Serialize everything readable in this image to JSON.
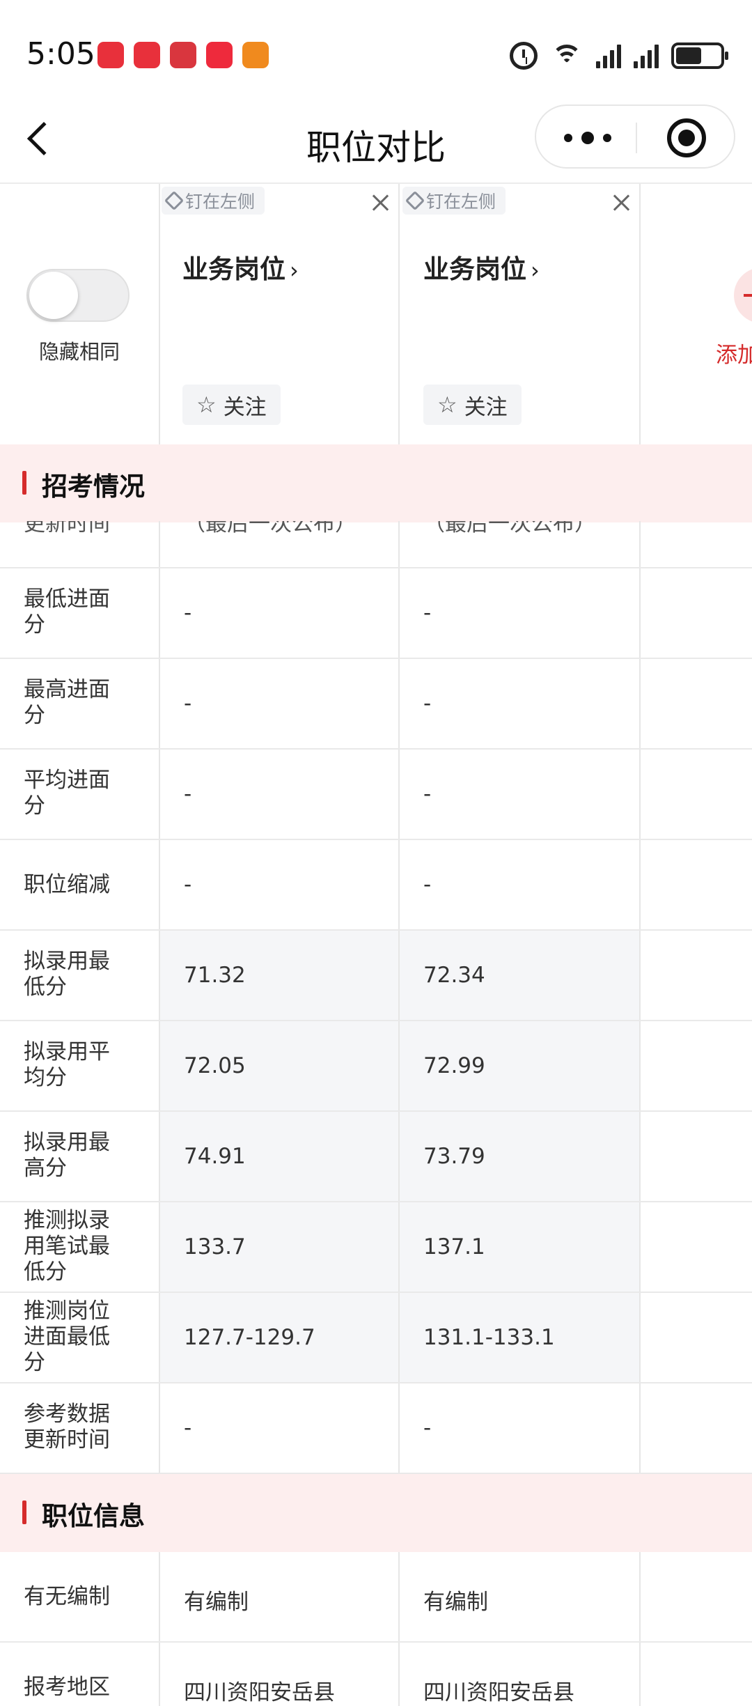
{
  "status_bar": {
    "time": "5:05",
    "apps": [
      {
        "icon": "huawei-store-icon",
        "label": "HUAWEI",
        "color": "#e8303b"
      },
      {
        "icon": "huawei-store-icon",
        "label": "HUAWEI",
        "color": "#e8303b"
      },
      {
        "icon": "game-app-icon",
        "label": "",
        "color": "#d9363e"
      },
      {
        "icon": "xiaohongshu-icon",
        "label": "小红书",
        "color": "#ee2a3c"
      },
      {
        "icon": "shopping-app-icon",
        "label": "",
        "color": "#f08a1e"
      }
    ],
    "icons": [
      "alarm-icon",
      "wifi-6-icon",
      "signal-icon",
      "signal-icon",
      "battery-icon"
    ]
  },
  "nav": {
    "title": "职位对比",
    "back_icon": "chevron-left-icon",
    "more_icon": "more-dots-icon",
    "close_icon": "target-circle-icon"
  },
  "compare": {
    "hide_same_label": "隐藏相同",
    "hide_same_on": false,
    "columns": [
      {
        "pin_label": "钉在左侧",
        "title": "业务岗位",
        "follow_label": "关注"
      },
      {
        "pin_label": "钉在左侧",
        "title": "业务岗位",
        "follow_label": "关注"
      }
    ],
    "add_label": "添加"
  },
  "sections": {
    "exam": {
      "title": "招考情况",
      "clipped_row": {
        "label": "更新时间",
        "a": "（最后一次公布）",
        "b": "（最后一次公布）"
      },
      "rows": [
        {
          "label": "最低进面分",
          "a": "-",
          "b": "-"
        },
        {
          "label": "最高进面分",
          "a": "-",
          "b": "-"
        },
        {
          "label": "平均进面分",
          "a": "-",
          "b": "-"
        },
        {
          "label": "职位缩减",
          "a": "-",
          "b": "-"
        },
        {
          "label": "拟录用最低分",
          "a": "71.32",
          "b": "72.34"
        },
        {
          "label": "拟录用平均分",
          "a": "72.05",
          "b": "72.99"
        },
        {
          "label": "拟录用最高分",
          "a": "74.91",
          "b": "73.79"
        },
        {
          "label": "推测拟录用笔试最低分",
          "a": "133.7",
          "b": "137.1"
        },
        {
          "label": "推测岗位进面最低分",
          "a": "127.7-129.7",
          "b": "131.1-133.1"
        },
        {
          "label": "参考数据更新时间",
          "a": "-",
          "b": "-"
        }
      ]
    },
    "job": {
      "title": "职位信息",
      "rows": [
        {
          "label": "有无编制",
          "a": "有编制",
          "b": "有编制"
        },
        {
          "label": "报考地区",
          "a": "四川资阳安岳县",
          "b": "四川资阳安岳县"
        }
      ]
    }
  },
  "colors": {
    "accent": "#d52b2b",
    "section_bg": "#fdeeee",
    "shaded_cell": "#f5f6f8"
  }
}
